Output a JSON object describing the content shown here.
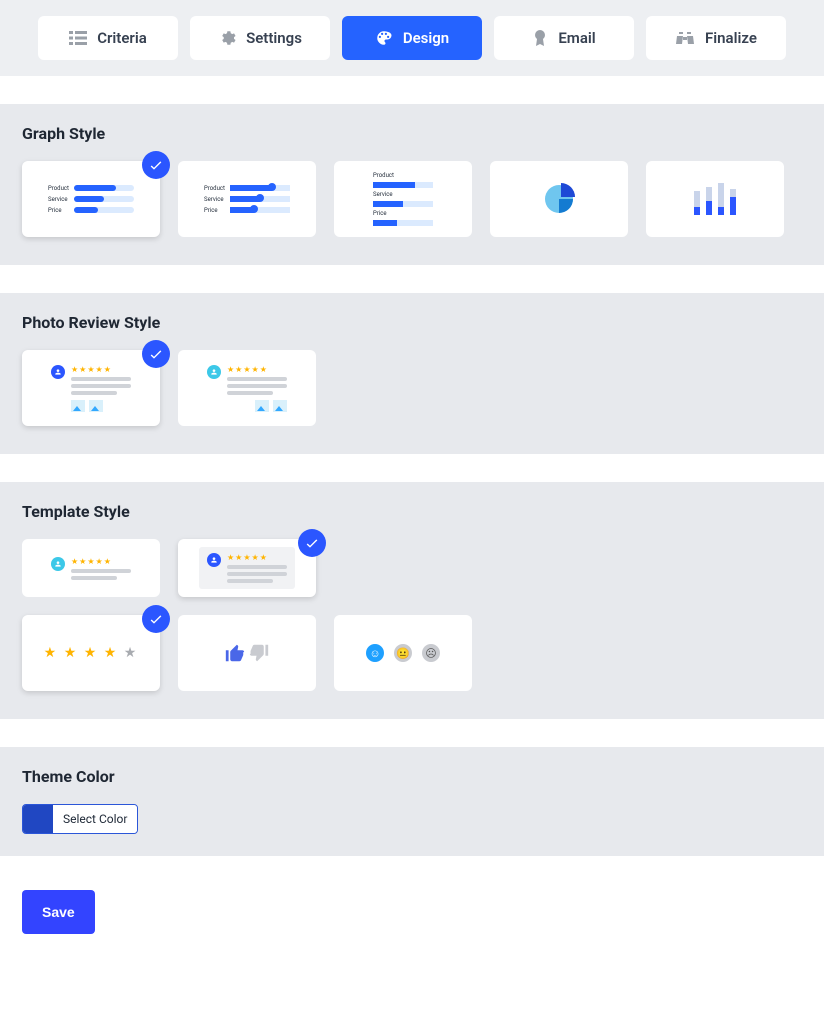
{
  "tabs": {
    "criteria": {
      "label": "Criteria"
    },
    "settings": {
      "label": "Settings"
    },
    "design": {
      "label": "Design"
    },
    "email": {
      "label": "Email"
    },
    "finalize": {
      "label": "Finalize"
    }
  },
  "active_tab": "design",
  "sections": {
    "graph": {
      "title": "Graph Style",
      "preview_labels": {
        "product": "Product",
        "service": "Service",
        "price": "Price"
      }
    },
    "photo": {
      "title": "Photo Review Style"
    },
    "template": {
      "title": "Template Style"
    },
    "theme": {
      "title": "Theme Color",
      "picker_label": "Select Color",
      "swatch_color": "#2047c2"
    }
  },
  "save_label": "Save"
}
